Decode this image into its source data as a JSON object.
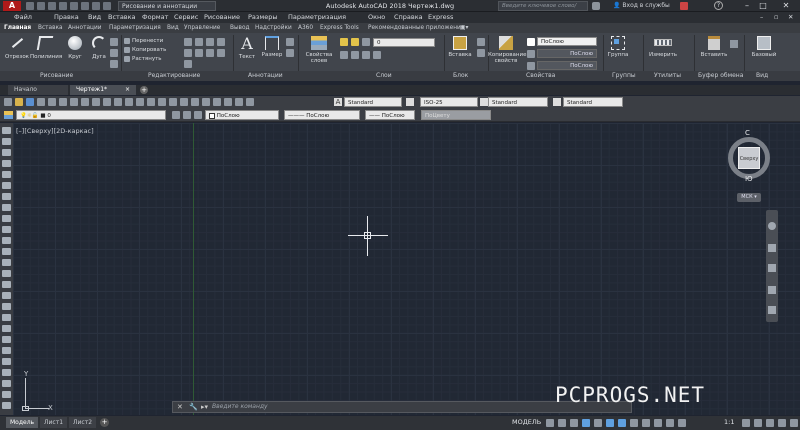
{
  "app": {
    "title": "Autodesk AutoCAD 2018  Чертеж1.dwg",
    "logo_letter": "A",
    "workspace": "Рисование и аннотации",
    "search_placeholder": "Введите ключевое слово/фразу",
    "login": "Вход в службы"
  },
  "menu": [
    "Файл",
    "Правка",
    "Вид",
    "Вставка",
    "Формат",
    "Сервис",
    "Рисование",
    "Размеры",
    "Параметризация",
    "Окно",
    "Справка",
    "Express"
  ],
  "ribbon_tabs": [
    "Главная",
    "Вставка",
    "Аннотации",
    "Параметризация",
    "Вид",
    "Управление",
    "Вывод",
    "Надстройки",
    "A360",
    "Express Tools",
    "Рекомендованные приложения"
  ],
  "ribbon": {
    "draw_tools": [
      "Отрезок",
      "Полилиния",
      "Круг",
      "Дуга"
    ],
    "modify_tools": [
      "Перенести",
      "Копировать",
      "Растянуть"
    ],
    "annotation_tools": [
      "Текст",
      "Размер"
    ],
    "layer_props": "Свойства слоев",
    "insert": "Вставка",
    "copy_props": "Копирование свойств",
    "prop_values": [
      "ПоСлою",
      "ПоСлою",
      "ПоСлою"
    ],
    "group": "Группа",
    "measure": "Измерить",
    "paste": "Вставить",
    "base": "Базовый",
    "panels": [
      "Рисование",
      "Редактирование",
      "Аннотации",
      "Слои",
      "Блок",
      "Свойства",
      "Группы",
      "Утилиты",
      "Буфер обмена",
      "Вид"
    ]
  },
  "doc_tabs": [
    "Начало",
    "Чертеж1*"
  ],
  "toolbar": {
    "text_style": "Standard",
    "dim_style": "ISO-25",
    "table_style": "Standard",
    "multileader_style": "Standard",
    "layer": "0",
    "color": "ПоСлою",
    "linetype": "ПоСлою",
    "lineweight": "ПоСлою",
    "plotstyle": "ПоЦвету"
  },
  "viewport": {
    "label": "[–][Сверху][2D-каркас]",
    "viewcube_n": "С",
    "viewcube_s": "Ю",
    "viewcube_face": "Сверху",
    "ucs_button": "МСК",
    "ucs_y": "Y",
    "ucs_x": "X"
  },
  "command_line": {
    "placeholder": "Введите команду"
  },
  "layout_tabs": [
    "Модель",
    "Лист1",
    "Лист2"
  ],
  "status": {
    "model": "МОДЕЛЬ",
    "scale": "1:1"
  },
  "watermark": "PCPROGS.NET",
  "colors": {
    "canvas": "#212834",
    "ribbon": "#41454c",
    "logo": "#b01a1a"
  }
}
